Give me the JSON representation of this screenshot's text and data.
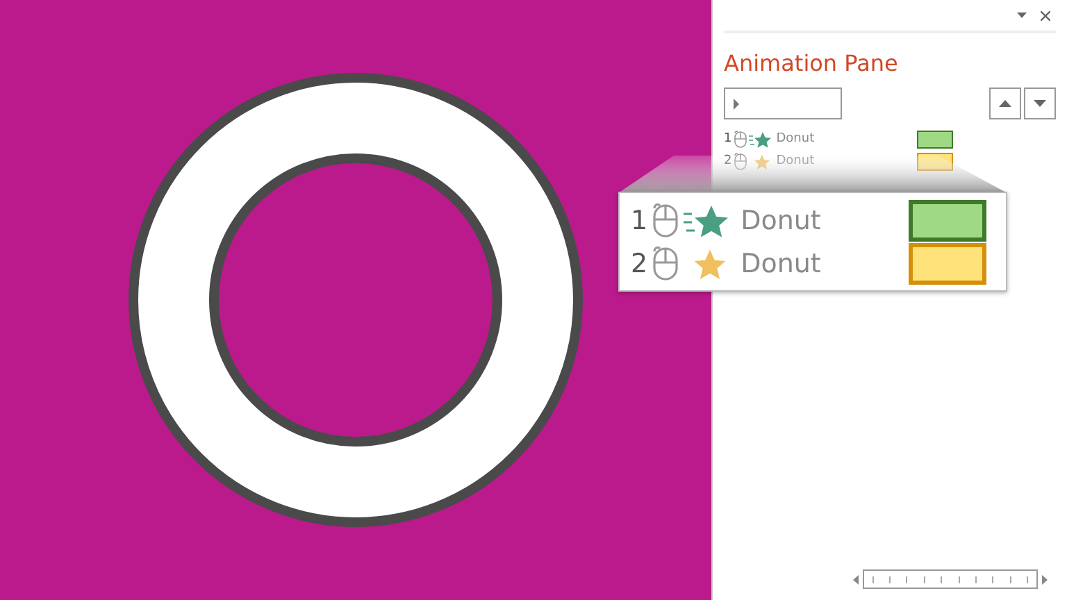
{
  "pane": {
    "title": "Animation Pane"
  },
  "animations": [
    {
      "number": "1",
      "name": "Donut",
      "kind": "moving",
      "color": "#9fd983"
    },
    {
      "number": "2",
      "name": "Donut",
      "kind": "still",
      "color": "#ffe37a"
    }
  ],
  "magnified_animations": [
    {
      "number": "1",
      "name": "Donut",
      "kind": "moving",
      "color": "#9fd983"
    },
    {
      "number": "2",
      "name": "Donut",
      "kind": "still",
      "color": "#ffe37a"
    }
  ]
}
